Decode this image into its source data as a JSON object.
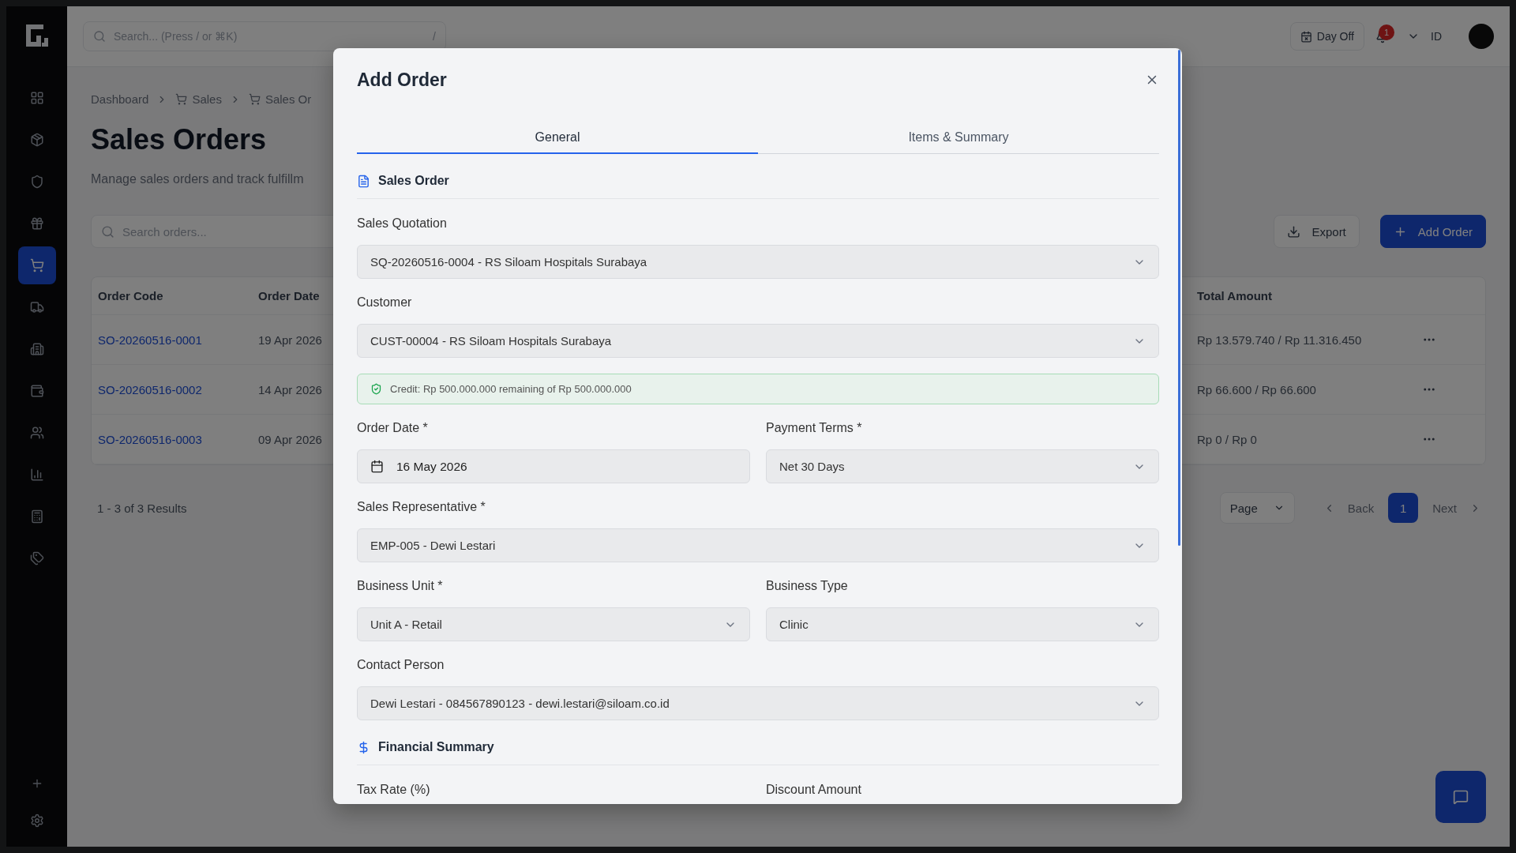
{
  "topbar": {
    "search_placeholder": "Search... (Press / or ⌘K)",
    "shortcut": "/",
    "day_off": "Day Off",
    "notification_count": "1",
    "language": "ID"
  },
  "sidebar": {
    "items": [
      {
        "selected": false
      },
      {
        "selected": false
      },
      {
        "selected": false
      },
      {
        "selected": false
      },
      {
        "selected": true
      },
      {
        "selected": false
      },
      {
        "selected": false
      },
      {
        "selected": false
      },
      {
        "selected": false
      },
      {
        "selected": false
      },
      {
        "selected": false
      },
      {
        "selected": false
      }
    ]
  },
  "breadcrumbs": [
    "Dashboard",
    "Sales",
    "Sales Or"
  ],
  "page": {
    "title": "Sales Orders",
    "subtitle": "Manage sales orders and track fulfillm",
    "search_placeholder": "Search orders...",
    "export": "Export",
    "add": "Add Order"
  },
  "table": {
    "columns": [
      "Order Code",
      "Order Date",
      "Total Amount"
    ],
    "rows": [
      {
        "order_code": "SO-20260516-0001",
        "order_date": "19 Apr 2026",
        "total_amount": "Rp 13.579.740 / Rp 11.316.450"
      },
      {
        "order_code": "SO-20260516-0002",
        "order_date": "14 Apr 2026",
        "total_amount": "Rp 66.600 / Rp 66.600"
      },
      {
        "order_code": "SO-20260516-0003",
        "order_date": "09 Apr 2026",
        "total_amount": "Rp 0 / Rp 0"
      }
    ]
  },
  "pagination": {
    "summary": "1 - 3 of 3 Results",
    "page_label": "Page",
    "back": "Back",
    "pages": [
      {
        "label": "1",
        "selected": true
      }
    ],
    "next": "Next"
  },
  "dialog": {
    "title": "Add Order",
    "tabs": [
      {
        "label": "General",
        "selected": true
      },
      {
        "label": "Items & Summary",
        "selected": false
      }
    ],
    "sections": [
      {
        "title": "Sales Order",
        "rows": [
          [
            {
              "kind": "select",
              "label": "Sales Quotation",
              "value": "SQ-20260516-0004 - RS Siloam Hospitals Surabaya"
            }
          ],
          [
            {
              "kind": "select",
              "label": "Customer",
              "value": "CUST-00004 - RS Siloam Hospitals Surabaya"
            }
          ],
          [
            {
              "kind": "alert",
              "text": "Credit: Rp 500.000.000 remaining of Rp 500.000.000"
            }
          ],
          [
            {
              "kind": "date",
              "label": "Order Date *",
              "value": "16 May 2026"
            },
            {
              "kind": "select",
              "label": "Payment Terms *",
              "value": "Net 30 Days"
            }
          ],
          [
            {
              "kind": "select",
              "label": "Sales Representative *",
              "value": "EMP-005 - Dewi Lestari"
            }
          ],
          [
            {
              "kind": "select",
              "label": "Business Unit *",
              "value": "Unit A - Retail"
            },
            {
              "kind": "select",
              "label": "Business Type",
              "value": "Clinic"
            }
          ],
          [
            {
              "kind": "select",
              "label": "Contact Person",
              "value": "Dewi Lestari - 084567890123 - dewi.lestari@siloam.co.id"
            }
          ]
        ]
      },
      {
        "title": "Financial Summary",
        "rows": [
          [
            {
              "kind": "label",
              "label": "Tax Rate (%)"
            },
            {
              "kind": "label",
              "label": "Discount Amount"
            }
          ]
        ]
      }
    ]
  }
}
